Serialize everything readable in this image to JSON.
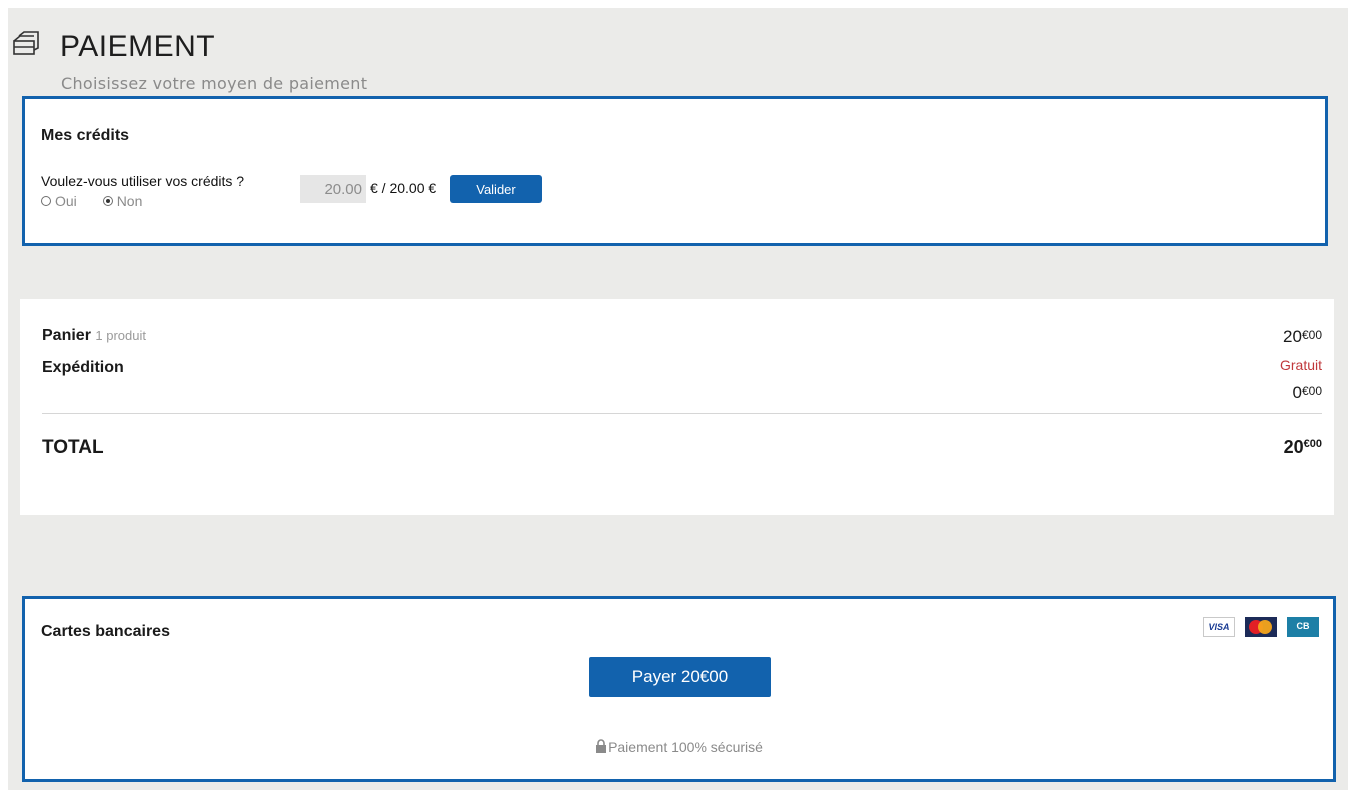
{
  "header": {
    "title": "PAIEMENT",
    "subtitle": "Choisissez votre moyen de paiement",
    "icon": "wallet-icon"
  },
  "credits": {
    "heading": "Mes crédits",
    "question": "Voulez-vous utiliser vos crédits ?",
    "options": [
      "Oui",
      "Non"
    ],
    "selected": "Non",
    "input_value": "20.00",
    "available_text": "€ / 20.00 €",
    "button_label": "Valider"
  },
  "summary": {
    "cart_label": "Panier",
    "cart_count": "1 produit",
    "cart_amount_main": "20",
    "cart_amount_sup": "€00",
    "shipping_label": "Expédition",
    "shipping_note": "Gratuit",
    "shipping_amount_main": "0",
    "shipping_amount_sup": "€00",
    "total_label": "TOTAL",
    "total_amount_main": "20",
    "total_amount_sup": "€00"
  },
  "cards": {
    "heading": "Cartes bancaires",
    "logos": [
      "VISA",
      "MasterCard",
      "CB"
    ],
    "cb_text": "CB",
    "visa_text": "VISA",
    "pay_button": "Payer 20€00",
    "secure_text": "Paiement 100% sécurisé"
  },
  "colors": {
    "brand_blue": "#1262ad",
    "free_red": "#c0383b",
    "background": "#ebebe9"
  }
}
